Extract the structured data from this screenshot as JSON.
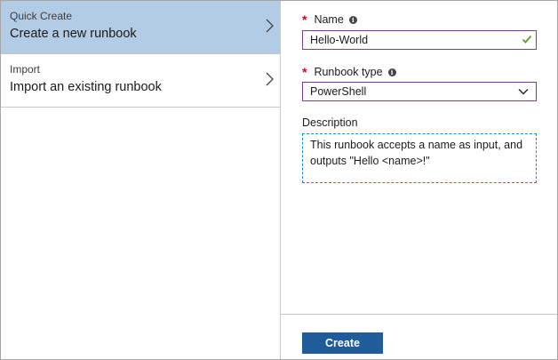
{
  "options": [
    {
      "title": "Quick Create",
      "description": "Create a new runbook",
      "selected": true
    },
    {
      "title": "Import",
      "description": "Import an existing runbook",
      "selected": false
    }
  ],
  "form": {
    "name": {
      "label": "Name",
      "required": true,
      "value": "Hello-World",
      "valid": true
    },
    "runbook_type": {
      "label": "Runbook type",
      "required": true,
      "value": "PowerShell"
    },
    "description": {
      "label": "Description",
      "value": "This runbook accepts a name as input, and outputs \"Hello <name>!\""
    },
    "create_label": "Create"
  },
  "colors": {
    "selected_bg": "#b3cce6",
    "required": "#d0021b",
    "input_border": "#7a3e8e",
    "focus_border": "#1f8ac9",
    "valid_check": "#5aa02c",
    "primary_button": "#1f5c99"
  },
  "icons": {
    "chevron_right": "chevron-right-icon",
    "info": "info-icon",
    "check": "check-icon",
    "chevron_down": "chevron-down-icon"
  }
}
